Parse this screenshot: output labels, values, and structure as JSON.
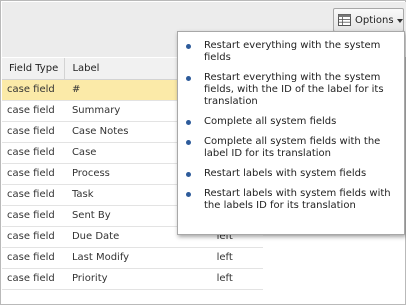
{
  "toolbar": {
    "options_label": "Options"
  },
  "table": {
    "headers": [
      "Field Type",
      "Label"
    ],
    "rows": [
      {
        "type": "case field",
        "label": "#",
        "align": ""
      },
      {
        "type": "case field",
        "label": "Summary",
        "align": ""
      },
      {
        "type": "case field",
        "label": "Case Notes",
        "align": ""
      },
      {
        "type": "case field",
        "label": "Case",
        "align": ""
      },
      {
        "type": "case field",
        "label": "Process",
        "align": ""
      },
      {
        "type": "case field",
        "label": "Task",
        "align": ""
      },
      {
        "type": "case field",
        "label": "Sent By",
        "align": ""
      },
      {
        "type": "case field",
        "label": "Due Date",
        "align": "left"
      },
      {
        "type": "case field",
        "label": "Last Modify",
        "align": "left"
      },
      {
        "type": "case field",
        "label": "Priority",
        "align": "left"
      }
    ],
    "selected_row": 0
  },
  "menu": {
    "items": [
      {
        "label": "Restart everything with the system fields"
      },
      {
        "label": "Restart everything with the system fields, with the ID of the label for its translation"
      },
      {
        "label": "Complete all system fields"
      },
      {
        "label": "Complete all system fields with the label ID for its translation"
      },
      {
        "label": "Restart labels with system fields"
      },
      {
        "label": "Restart labels with system fields with the labels ID for its translation"
      }
    ]
  },
  "colors": {
    "selected_row": "#fbeaa8",
    "bullet": "#2d5b9a",
    "toolbar_bg": "#ececec"
  }
}
